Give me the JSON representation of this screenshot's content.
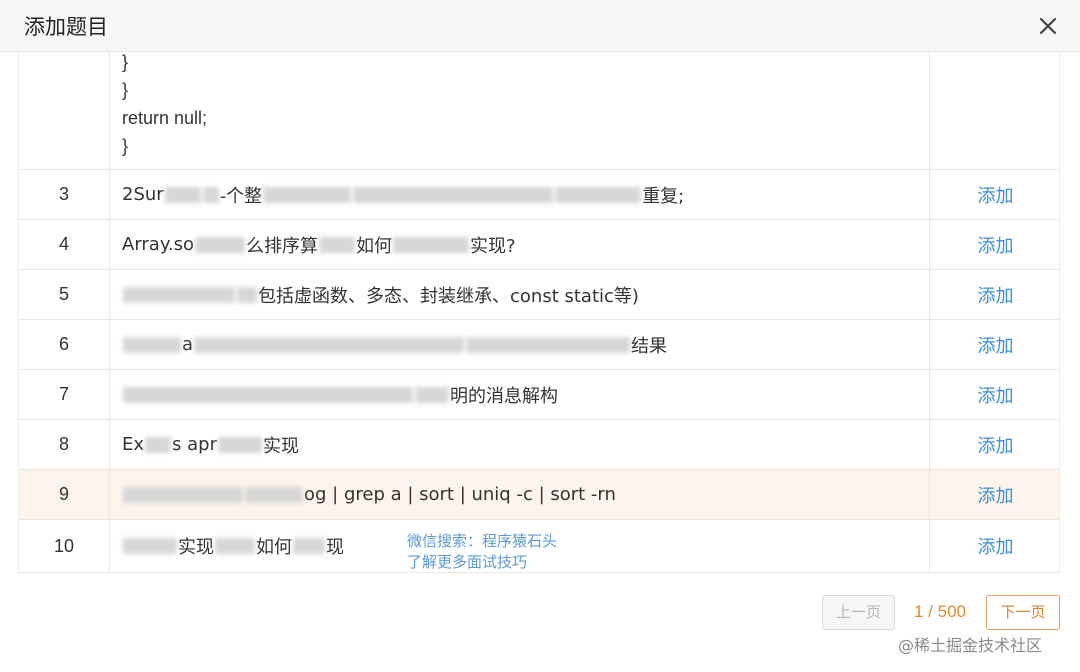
{
  "dialog": {
    "title": "添加题目",
    "close_icon": "close-icon"
  },
  "partial_row": {
    "code_lines": [
      "}",
      "}",
      "return null;",
      "}"
    ]
  },
  "rows": [
    {
      "num": "3",
      "visible": [
        "2Sur",
        "-个整",
        "重复;"
      ]
    },
    {
      "num": "4",
      "visible": [
        "Array.so",
        "么排序算",
        "如何",
        "实现?"
      ]
    },
    {
      "num": "5",
      "visible": [
        "包括虚函数、多态、封装继承、const static等)"
      ]
    },
    {
      "num": "6",
      "visible": [
        "a",
        "结果"
      ]
    },
    {
      "num": "7",
      "visible": [
        "明的消息解构"
      ]
    },
    {
      "num": "8",
      "visible": [
        "Ex",
        "s apr",
        "实现"
      ]
    },
    {
      "num": "9",
      "visible": [
        "og | grep a | sort | uniq -c | sort -rn"
      ]
    },
    {
      "num": "10",
      "visible": [
        "实现",
        "如何",
        "现"
      ]
    }
  ],
  "action_label": "添加",
  "watermark": {
    "line1": "微信搜索：程序猿石头",
    "line2": "了解更多面试技巧"
  },
  "pagination": {
    "prev_label": "上一页",
    "info": "1 / 500",
    "next_label": "下一页"
  },
  "site_watermark": "@稀土掘金技术社区",
  "colors": {
    "link": "#3a8ee6",
    "highlight_row": "#fdf5eb",
    "pager_accent": "#e0892b"
  }
}
